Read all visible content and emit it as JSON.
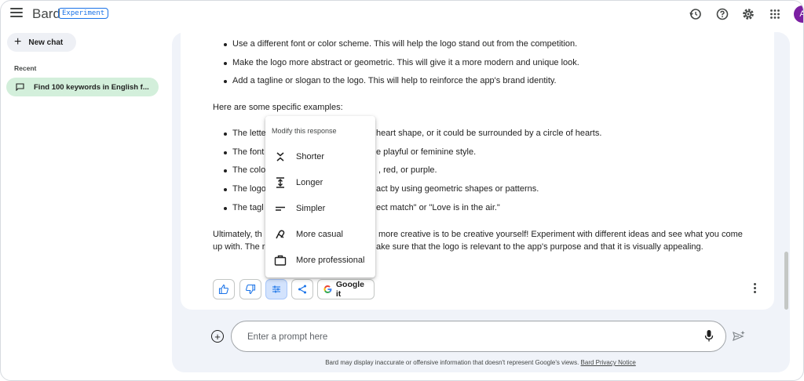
{
  "header": {
    "brand": "Bard",
    "badge": "Experiment",
    "icons": [
      "history-icon",
      "help-icon",
      "settings-icon",
      "apps-grid-icon"
    ],
    "avatar_initial": "A"
  },
  "sidebar": {
    "new_chat_label": "New chat",
    "recent_label": "Recent",
    "recent_items": [
      {
        "label": "Find 100 keywords in English f..."
      }
    ]
  },
  "response": {
    "bullets_top": [
      "Use a different font or color scheme. This will help the logo stand out from the competition.",
      "Make the logo more abstract or geometric. This will give it a more modern and unique look.",
      "Add a tagline or slogan to the logo. This will help to reinforce the app's brand identity."
    ],
    "examples_heading": "Here are some specific examples:",
    "bullets_examples_start": [
      "The lette",
      "The font",
      "The colo",
      "The logo",
      "The tagl"
    ],
    "bullets_examples_end": [
      "heart shape, or it could be surrounded by a circle of hearts.",
      "e playful or feminine style.",
      ", red, or purple.",
      "act by using geometric shapes or patterns.",
      "ect match\" or \"Love is in the air.\""
    ],
    "conclusion_line1_start": "Ultimately, th",
    "conclusion_line1_end": "more creative is to be creative yourself! Experiment with different ideas and see what you come",
    "conclusion_line2_start": "up with. The r",
    "conclusion_line2_end": "ake sure that the logo is relevant to the app's purpose and that it is visually appealing."
  },
  "actions": {
    "google_it_label": "Google it"
  },
  "modify_menu": {
    "title": "Modify this response",
    "items": [
      {
        "label": "Shorter",
        "icon": "shorter-icon"
      },
      {
        "label": "Longer",
        "icon": "longer-icon"
      },
      {
        "label": "Simpler",
        "icon": "simpler-icon"
      },
      {
        "label": "More casual",
        "icon": "casual-icon"
      },
      {
        "label": "More professional",
        "icon": "professional-icon"
      }
    ]
  },
  "prompt": {
    "placeholder": "Enter a prompt here"
  },
  "footer": {
    "disclaimer": "Bard may display inaccurate or offensive information that doesn't represent Google's views.",
    "privacy_link": "Bard Privacy Notice"
  },
  "colors": {
    "accent": "#1a73e8",
    "recent_item_bg": "#d3efdb",
    "panel_bg": "#f0f3f9",
    "active_button_bg": "#d3e3fd"
  }
}
